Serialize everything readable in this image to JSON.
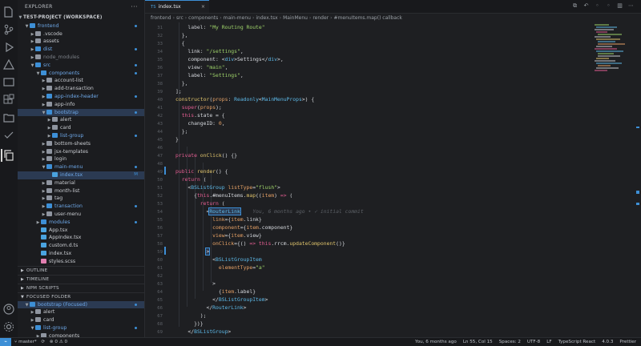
{
  "sidebar": {
    "title": "EXPLORER",
    "workspace": "TEST-PROJECT (WORKSPACE)",
    "tree": [
      {
        "label": "frontend",
        "depth": 0,
        "type": "root",
        "chev": "open",
        "color": "blue",
        "dot": true
      },
      {
        "label": ".vscode",
        "depth": 1,
        "type": "folder",
        "chev": "closed"
      },
      {
        "label": "assets",
        "depth": 1,
        "type": "folder",
        "chev": "closed"
      },
      {
        "label": "dist",
        "depth": 1,
        "type": "folder",
        "chev": "closed",
        "color": "blue",
        "dot": true
      },
      {
        "label": "node_modules",
        "depth": 1,
        "type": "folder",
        "chev": "closed",
        "dim": true
      },
      {
        "label": "src",
        "depth": 1,
        "type": "folder",
        "chev": "open",
        "color": "blue",
        "dot": true
      },
      {
        "label": "components",
        "depth": 2,
        "type": "folder",
        "chev": "open",
        "color": "blue",
        "dot": true
      },
      {
        "label": "account-list",
        "depth": 3,
        "type": "folder",
        "chev": "closed"
      },
      {
        "label": "add-transaction",
        "depth": 3,
        "type": "folder",
        "chev": "closed"
      },
      {
        "label": "app-index-header",
        "depth": 3,
        "type": "folder",
        "chev": "closed",
        "color": "blue",
        "dot": true
      },
      {
        "label": "app-info",
        "depth": 3,
        "type": "folder",
        "chev": "closed"
      },
      {
        "label": "bootstrap",
        "depth": 3,
        "type": "folder",
        "chev": "open",
        "color": "blue",
        "dot": true,
        "selected": true
      },
      {
        "label": "alert",
        "depth": 4,
        "type": "folder",
        "chev": "closed"
      },
      {
        "label": "card",
        "depth": 4,
        "type": "folder",
        "chev": "closed"
      },
      {
        "label": "list-group",
        "depth": 4,
        "type": "folder",
        "chev": "closed",
        "color": "blue",
        "dot": true
      },
      {
        "label": "bottom-sheets",
        "depth": 3,
        "type": "folder",
        "chev": "closed"
      },
      {
        "label": "jsx-templates",
        "depth": 3,
        "type": "folder",
        "chev": "closed"
      },
      {
        "label": "login",
        "depth": 3,
        "type": "folder",
        "chev": "closed"
      },
      {
        "label": "main-menu",
        "depth": 3,
        "type": "folder",
        "chev": "open",
        "color": "blue",
        "dot": true
      },
      {
        "label": "index.tsx",
        "depth": 4,
        "type": "tsx",
        "color": "blue",
        "badge": "M",
        "selected": true
      },
      {
        "label": "material",
        "depth": 3,
        "type": "folder",
        "chev": "closed"
      },
      {
        "label": "month-list",
        "depth": 3,
        "type": "folder",
        "chev": "closed"
      },
      {
        "label": "tag",
        "depth": 3,
        "type": "folder",
        "chev": "closed"
      },
      {
        "label": "transaction",
        "depth": 3,
        "type": "folder",
        "chev": "closed",
        "color": "blue",
        "dot": true
      },
      {
        "label": "user-menu",
        "depth": 3,
        "type": "folder",
        "chev": "closed"
      },
      {
        "label": "modules",
        "depth": 2,
        "type": "folder",
        "chev": "closed",
        "color": "blue",
        "dot": true
      },
      {
        "label": "App.tsx",
        "depth": 2,
        "type": "tsx"
      },
      {
        "label": "AppIndex.tsx",
        "depth": 2,
        "type": "tsx"
      },
      {
        "label": "custom.d.ts",
        "depth": 2,
        "type": "ts"
      },
      {
        "label": "index.tsx",
        "depth": 2,
        "type": "tsx"
      },
      {
        "label": "styles.scss",
        "depth": 2,
        "type": "scss"
      }
    ],
    "sections": [
      "OUTLINE",
      "TIMELINE",
      "NPM SCRIPTS",
      "FOCUSED FOLDER"
    ],
    "focused": [
      {
        "label": "bootstrap (Focused)",
        "depth": 0,
        "chev": "open",
        "color": "blue",
        "dot": true,
        "selected": true
      },
      {
        "label": "alert",
        "depth": 1,
        "chev": "closed"
      },
      {
        "label": "card",
        "depth": 1,
        "chev": "closed"
      },
      {
        "label": "list-group",
        "depth": 1,
        "chev": "open",
        "color": "blue",
        "dot": true
      },
      {
        "label": "components",
        "depth": 2,
        "chev": "closed"
      }
    ]
  },
  "editor": {
    "tab_label": "index.tsx",
    "tab_ext": "TS",
    "breadcrumbs": [
      "frontend",
      "src",
      "components",
      "main-menu",
      "index.tsx",
      "MainMenu",
      "render",
      "#menuItems.map() callback"
    ],
    "blame": "You, 6 months ago • ✓ initial commit"
  },
  "status": {
    "branch": "master*",
    "sync": "⟳",
    "errors": "⊗ 0",
    "warnings": "⚠ 0",
    "items": [
      "You, 6 months ago",
      "Ln 55, Col 15",
      "Spaces: 2",
      "UTF-8",
      "LF",
      "TypeScript React",
      "4.0.3",
      "Prettier"
    ]
  },
  "colors": {
    "accent": "#3d8fd6",
    "background": "#1e1f22",
    "sidebar": "#1b1c1f"
  }
}
